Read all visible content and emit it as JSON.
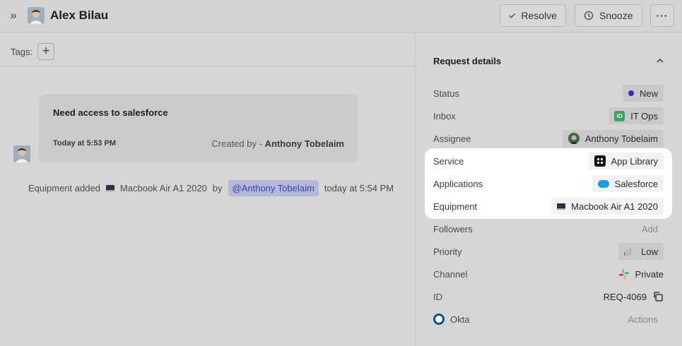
{
  "header": {
    "user_name": "Alex Bilau",
    "expand_glyph": "»",
    "resolve_label": "Resolve",
    "snooze_label": "Snooze",
    "more_glyph": "···"
  },
  "tags": {
    "label": "Tags:",
    "add_glyph": "+"
  },
  "request_card": {
    "title": "Need access to salesforce",
    "time": "Today at 5:53 PM",
    "created_by_prefix": "Created by -",
    "created_by_name": "Anthony Tobelaim"
  },
  "event": {
    "text": "Equipment added",
    "item": "Macbook Air A1 2020",
    "by": "by",
    "mention": "@Anthony Tobelaim",
    "time": "today at 5:54 PM"
  },
  "details": {
    "title": "Request details",
    "collapse_glyph": "⌃",
    "rows": [
      {
        "label": "Status",
        "value": "New",
        "icon": "dot-icon",
        "color": "#2e32b8"
      },
      {
        "label": "Inbox",
        "value": "IT Ops",
        "icon": "it-ops-icon",
        "icon_text": "IO",
        "color": "#3aa55c"
      },
      {
        "label": "Assignee",
        "value": "Anthony Tobelaim",
        "icon": "avatar-icon"
      },
      {
        "label": "Service",
        "value": "App Library",
        "icon": "app-library-icon"
      },
      {
        "label": "Applications",
        "value": "Salesforce",
        "icon": "salesforce-icon",
        "color": "#1aa0e0"
      },
      {
        "label": "Equipment",
        "value": "Macbook Air A1 2020",
        "icon": "laptop-icon"
      },
      {
        "label": "Followers",
        "value": "Add"
      },
      {
        "label": "Priority",
        "value": "Low",
        "icon": "priority-icon"
      },
      {
        "label": "Channel",
        "value": "Private",
        "icon": "slack-icon"
      },
      {
        "label": "ID",
        "value": "REQ-4069",
        "icon": "copy-icon"
      },
      {
        "label": "Okta",
        "value": "Actions",
        "icon": "okta-icon",
        "color": "#0f4f9e"
      }
    ]
  }
}
